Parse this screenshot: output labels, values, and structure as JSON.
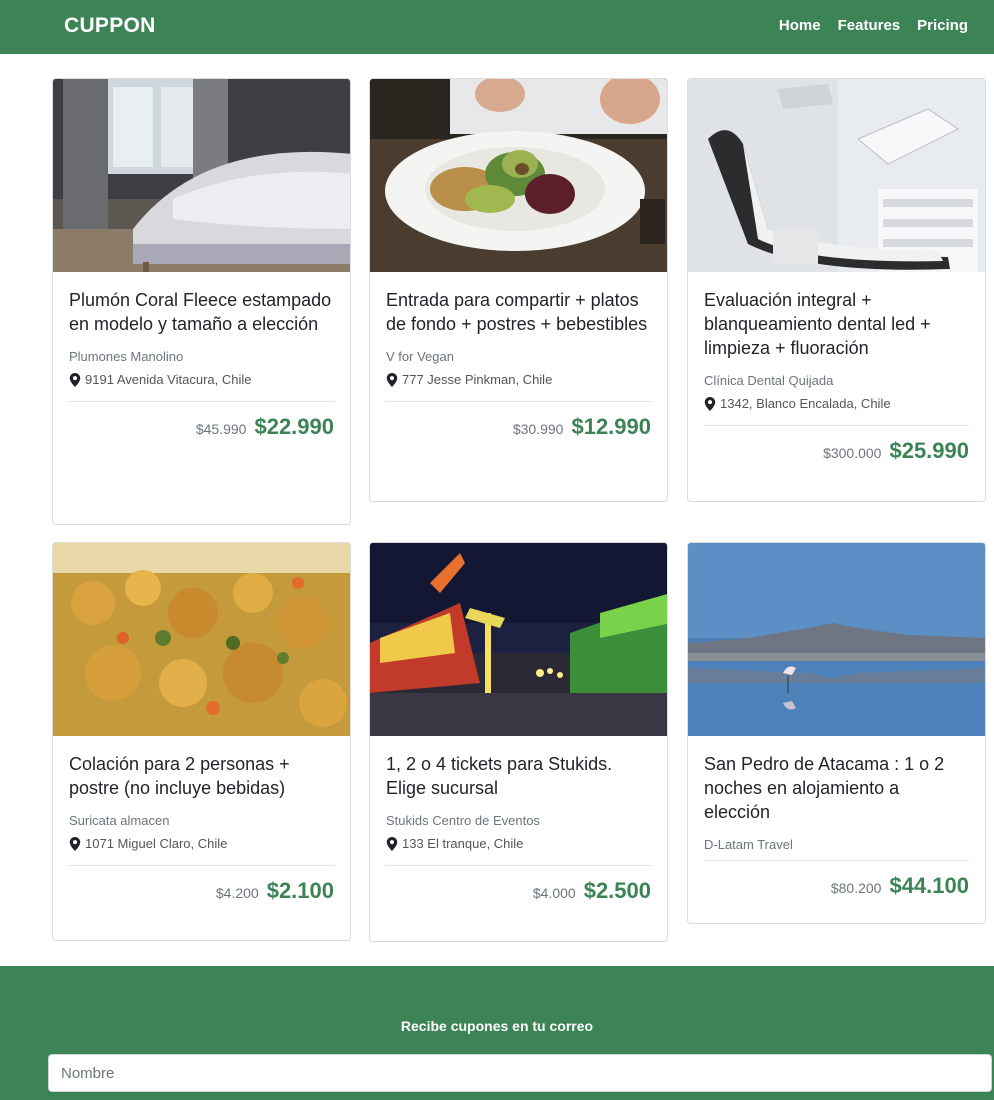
{
  "navbar": {
    "brand": "CUPPON",
    "links": [
      "Home",
      "Features",
      "Pricing"
    ]
  },
  "cards": [
    {
      "image": "bedroom-photo",
      "title_lines": [
        "Plumón Coral Fleece estampado",
        "en modelo y tamaño a elección"
      ],
      "merchant": "Plumones Manolino",
      "location": "9191 Avenida Vitacura, Chile",
      "old_price": "$45.990",
      "new_price": "$22.990"
    },
    {
      "image": "vegan-salad-photo",
      "title_lines": [
        "Entrada para compartir + platos de fondo + postres + bebestibles"
      ],
      "merchant": "V for Vegan",
      "location": "777 Jesse Pinkman, Chile",
      "old_price": "$30.990",
      "new_price": "$12.990"
    },
    {
      "image": "dental-chair-photo",
      "title_lines": [
        "Evaluación integral + blanqueamiento dental led + limpieza + fluoración"
      ],
      "merchant": "Clínica Dental Quijada",
      "location": "1342, Blanco Encalada, Chile",
      "old_price": "$300.000",
      "new_price": "$25.990"
    },
    {
      "image": "curry-dish-photo",
      "title_lines": [
        "Colación para 2 personas + postre (no incluye bebidas)"
      ],
      "merchant": "Suricata almacen",
      "location": "1071 Miguel Claro, Chile",
      "old_price": "$4.200",
      "new_price": "$2.100"
    },
    {
      "image": "fair-rides-photo",
      "title_lines": [
        "1, 2 o 4 tickets para Stukids. Elige sucursal"
      ],
      "merchant": "Stukids Centro de Eventos",
      "location": "133 El tranque, Chile",
      "old_price": "$4.000",
      "new_price": "$2.500"
    },
    {
      "image": "flamingo-lake-photo",
      "title_lines": [
        "San Pedro de Atacama : 1 o 2 noches en alojamiento a elección"
      ],
      "merchant": "D-Latam Travel",
      "location": "",
      "old_price": "$80.200",
      "new_price": "$44.100"
    }
  ],
  "footer": {
    "title": "Recibe cupones en tu correo",
    "name_placeholder": "Nombre"
  },
  "colors": {
    "brand_green": "#3c8456",
    "text_muted": "#6c757d"
  }
}
